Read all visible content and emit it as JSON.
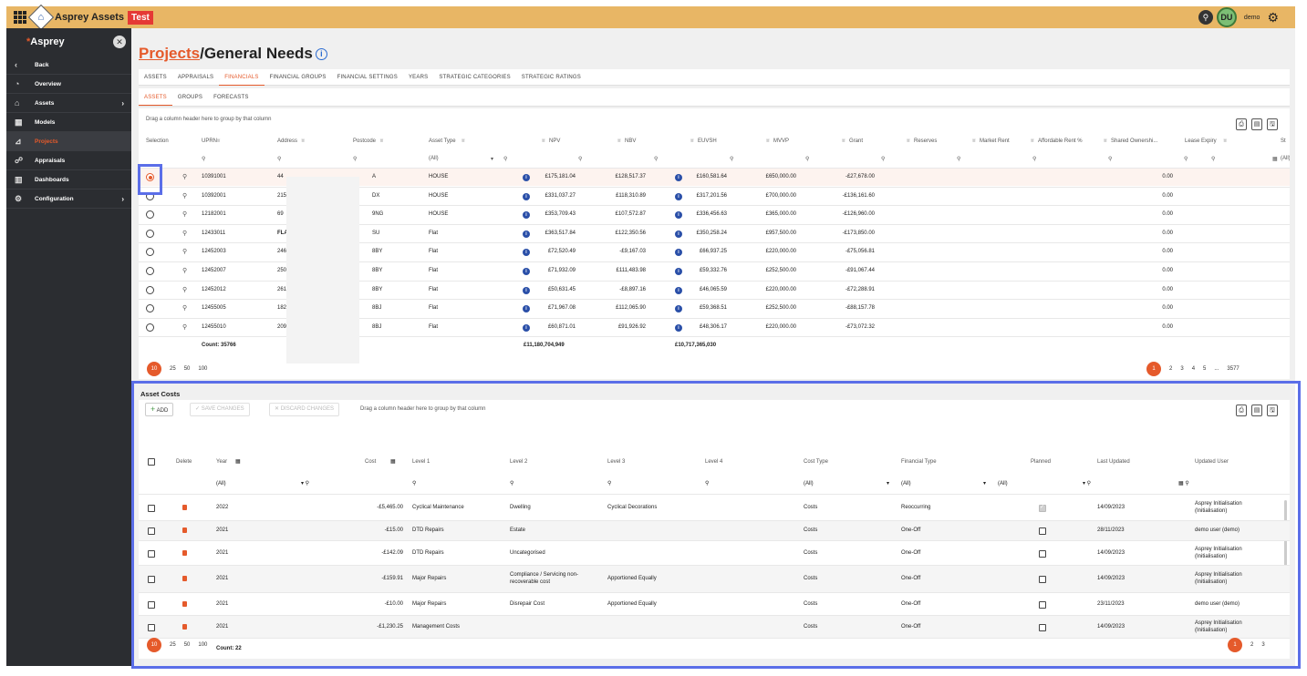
{
  "app": {
    "title": "Asprey Assets",
    "env_badge": "Test",
    "user_initials": "DU",
    "user_name": "demo",
    "logo_text": "Asprey"
  },
  "sidebar": {
    "items": [
      {
        "label": "Back",
        "icon": "chevron-left-icon",
        "name": "sidebar-item-back"
      },
      {
        "label": "Overview",
        "icon": "overview-icon",
        "name": "sidebar-item-overview"
      },
      {
        "label": "Assets",
        "icon": "house-icon",
        "name": "sidebar-item-assets",
        "chevron": true
      },
      {
        "label": "Models",
        "icon": "models-icon",
        "name": "sidebar-item-models"
      },
      {
        "label": "Projects",
        "icon": "chart-icon",
        "name": "sidebar-item-projects",
        "active": true
      },
      {
        "label": "Appraisals",
        "icon": "appraisals-icon",
        "name": "sidebar-item-appraisals"
      },
      {
        "label": "Dashboards",
        "icon": "dashboard-icon",
        "name": "sidebar-item-dashboards"
      },
      {
        "label": "Configuration",
        "icon": "gear-icon",
        "name": "sidebar-item-configuration",
        "chevron": true
      }
    ]
  },
  "page": {
    "title_link": "Projects",
    "title_rest": "/General Needs"
  },
  "tabs": [
    "ASSETS",
    "APPRAISALS",
    "FINANCIALS",
    "FINANCIAL GROUPS",
    "FINANCIAL SETTINGS",
    "YEARS",
    "STRATEGIC CATEGORIES",
    "STRATEGIC RATINGS"
  ],
  "active_tab": 2,
  "subtabs": [
    "ASSETS",
    "GROUPS",
    "FORECASTS"
  ],
  "grid1": {
    "drag_hint": "Drag a column header here to group by that column",
    "headers": [
      "Selection",
      "UPRN",
      "Address",
      "Postcode",
      "Asset Type",
      "NPV",
      "NBV",
      "EUVSH",
      "MVVP",
      "Grant",
      "Reserves",
      "Market Rent",
      "Affordable Rent %",
      "Shared Ownershi...",
      "Lease Expiry",
      "St"
    ],
    "asset_type_filter": "(All)",
    "lease_filter": "(All)",
    "rows": [
      {
        "uprn": "10391001",
        "addr": "44",
        "postcode": "A",
        "type": "HOUSE",
        "npv": "£175,181.04",
        "nbv": "£128,517.37",
        "euvsh": "£160,581.64",
        "mvvp": "£650,000.00",
        "grant": "-£27,678.00",
        "so": "0.00",
        "selected": true
      },
      {
        "uprn": "10392001",
        "addr": "215",
        "postcode": "DX",
        "type": "HOUSE",
        "npv": "£331,037.27",
        "nbv": "£118,310.89",
        "euvsh": "£317,201.56",
        "mvvp": "£700,000.00",
        "grant": "-£136,161.60",
        "so": "0.00"
      },
      {
        "uprn": "12182001",
        "addr": "69",
        "postcode": "9NG",
        "type": "HOUSE",
        "npv": "£353,709.43",
        "nbv": "£107,572.87",
        "euvsh": "£336,456.63",
        "mvvp": "£365,000.00",
        "grant": "-£126,960.00",
        "so": "0.00"
      },
      {
        "uprn": "12433011",
        "addr": "FLA",
        "postcode": "SU",
        "type": "Flat",
        "npv": "£363,517.84",
        "nbv": "£122,350.56",
        "euvsh": "£350,258.24",
        "mvvp": "£957,500.00",
        "grant": "-£173,850.00",
        "so": "0.00"
      },
      {
        "uprn": "12452003",
        "addr": "246",
        "postcode": "8BY",
        "type": "Flat",
        "npv": "£72,520.49",
        "nbv": "-£9,167.03",
        "euvsh": "£66,937.25",
        "mvvp": "£220,000.00",
        "grant": "-£75,056.81",
        "so": "0.00"
      },
      {
        "uprn": "12452007",
        "addr": "250",
        "postcode": "8BY",
        "type": "Flat",
        "npv": "£71,932.09",
        "nbv": "£111,483.98",
        "euvsh": "£59,332.76",
        "mvvp": "£252,500.00",
        "grant": "-£91,067.44",
        "so": "0.00"
      },
      {
        "uprn": "12452012",
        "addr": "261",
        "postcode": "8BY",
        "type": "Flat",
        "npv": "£50,631.45",
        "nbv": "-£8,897.16",
        "euvsh": "£46,065.59",
        "mvvp": "£220,000.00",
        "grant": "-£72,288.91",
        "so": "0.00"
      },
      {
        "uprn": "12455005",
        "addr": "182",
        "postcode": "8BJ",
        "type": "Flat",
        "npv": "£71,967.08",
        "nbv": "£112,065.90",
        "euvsh": "£59,368.51",
        "mvvp": "£252,500.00",
        "grant": "-£88,157.78",
        "so": "0.00"
      },
      {
        "uprn": "12455010",
        "addr": "209",
        "postcode": "8BJ",
        "type": "Flat",
        "npv": "£60,871.01",
        "nbv": "£91,926.92",
        "euvsh": "£48,306.17",
        "mvvp": "£220,000.00",
        "grant": "-£73,072.32",
        "so": "0.00"
      }
    ],
    "count": "Count: 35766",
    "npv_total": "£11,180,704,949",
    "euvsh_total": "£10,717,365,030",
    "page_sizes": [
      "10",
      "25",
      "50",
      "100"
    ],
    "pages": [
      "1",
      "2",
      "3",
      "4",
      "5",
      "...",
      "3577"
    ]
  },
  "asset_costs": {
    "title": "Asset Costs",
    "add_label": "ADD",
    "save_label": "SAVE CHANGES",
    "discard_label": "DISCARD CHANGES",
    "drag_hint": "Drag a column header here to group by that column",
    "headers": [
      "Delete",
      "Year",
      "Cost",
      "Level 1",
      "Level 2",
      "Level 3",
      "Level 4",
      "Cost Type",
      "Financial Type",
      "Planned",
      "Last Updated",
      "Updated User"
    ],
    "filters": {
      "year": "(All)",
      "cost_type": "(All)",
      "financial_type": "(All)",
      "planned": "(All)"
    },
    "rows": [
      {
        "year": "2022",
        "cost": "-£5,465.00",
        "l1": "Cyclical Maintenance",
        "l2": "Dwelling",
        "l3": "Cyclical Decorations",
        "ctype": "Costs",
        "ftype": "Reoccurring",
        "planned": true,
        "updated": "14/09/2023",
        "user1": "Asprey Initialisation",
        "user2": "(Initialisation)"
      },
      {
        "year": "2021",
        "cost": "-£15.00",
        "l1": "DTD Repairs",
        "l2": "Estate",
        "l3": "",
        "ctype": "Costs",
        "ftype": "One-Off",
        "planned": false,
        "updated": "28/11/2023",
        "user1": "demo user (demo)",
        "user2": ""
      },
      {
        "year": "2021",
        "cost": "-£142.09",
        "l1": "DTD Repairs",
        "l2": "Uncategorised",
        "l3": "",
        "ctype": "Costs",
        "ftype": "One-Off",
        "planned": false,
        "updated": "14/09/2023",
        "user1": "Asprey Initialisation",
        "user2": "(Initialisation)"
      },
      {
        "year": "2021",
        "cost": "-£159.91",
        "l1": "Major Repairs",
        "l2": "Compliance / Servicing non-",
        "l2b": "recoverable cost",
        "l3": "Apportioned Equally",
        "ctype": "Costs",
        "ftype": "One-Off",
        "planned": false,
        "updated": "14/09/2023",
        "user1": "Asprey Initialisation",
        "user2": "(Initialisation)"
      },
      {
        "year": "2021",
        "cost": "-£10.00",
        "l1": "Major Repairs",
        "l2": "Disrepair Cost",
        "l3": "Apportioned Equally",
        "ctype": "Costs",
        "ftype": "One-Off",
        "planned": false,
        "updated": "23/11/2023",
        "user1": "demo user (demo)",
        "user2": ""
      },
      {
        "year": "2021",
        "cost": "-£1,230.25",
        "l1": "Management Costs",
        "l2": "",
        "l3": "",
        "ctype": "Costs",
        "ftype": "One-Off",
        "planned": false,
        "updated": "14/09/2023",
        "user1": "Asprey Initialisation",
        "user2": "(Initialisation)"
      }
    ],
    "count": "Count: 22",
    "page_sizes": [
      "10",
      "25",
      "50",
      "100"
    ],
    "pages": [
      "1",
      "2",
      "3"
    ]
  }
}
